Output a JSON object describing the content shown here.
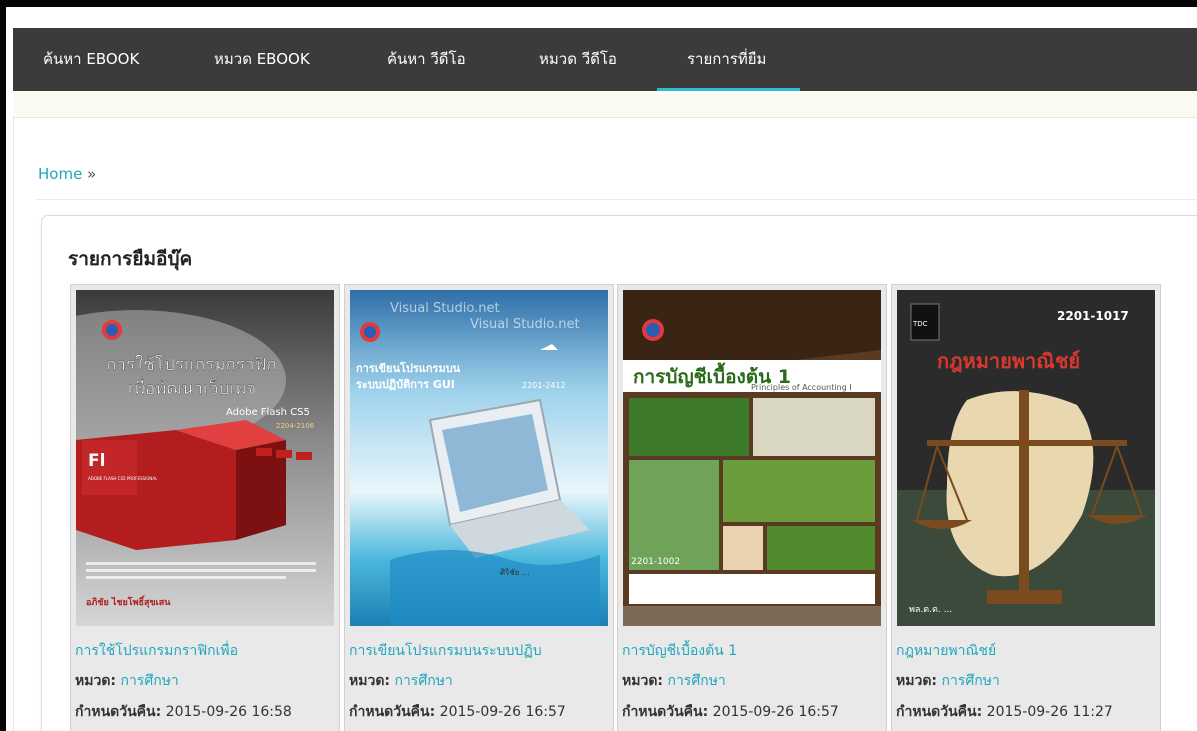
{
  "nav": {
    "items": [
      {
        "label": "ค้นหา EBOOK"
      },
      {
        "label": "หมวด EBOOK"
      },
      {
        "label": "ค้นหา วีดีโอ"
      },
      {
        "label": "หมวด วีดีโอ"
      },
      {
        "label": "รายการที่ยืม"
      }
    ],
    "active_index": 4
  },
  "breadcrumb": {
    "home": "Home",
    "separator": "»"
  },
  "section": {
    "title": "รายการยืมอีบุ๊ค"
  },
  "labels": {
    "category": "หมวด:",
    "due": "กำหนดวันคืน:"
  },
  "colors": {
    "accent": "#21a6bf",
    "nav_bg": "#3b3b3b",
    "active_underline": "#2dbcd3"
  },
  "books": [
    {
      "title": "การใช้โปรแกรมกราฟิกเพื่อ",
      "category": "การศึกษา",
      "due": "2015-09-26 16:58",
      "cover": {
        "title_line1": "การใช้โปรแกรมกราฟิก",
        "title_line2": "เพื่อพัฒนาเว็บเพจ",
        "subtitle": "Adobe Flash CS5",
        "code": "2204-2106",
        "logo_text": "Fl",
        "product_name": "ADOBE FLASH CS5 PROFESSIONAL",
        "author": "อภิชัย ไชยโพธิ์สุขเสน"
      }
    },
    {
      "title": "การเขียนโปรแกรมบนระบบปฏิบ",
      "category": "การศึกษา",
      "due": "2015-09-26 16:57",
      "cover": {
        "watermark": "Visual Studio.net",
        "title_line1": "การเขียนโปรแกรมบน",
        "title_line2": "ระบบปฏิบัติการ GUI",
        "code": "2201-2412"
      }
    },
    {
      "title": "การบัญชีเบื้องต้น 1",
      "category": "การศึกษา",
      "due": "2015-09-26 16:57",
      "cover": {
        "title": "การบัญชีเบื้องต้น 1",
        "subtitle": "Principles of Accounting I",
        "code": "2201-1002"
      }
    },
    {
      "title": "กฎหมายพาณิชย์",
      "category": "การศึกษา",
      "due": "2015-09-26 11:27",
      "cover": {
        "code": "2201-1017",
        "title": "กฎหมายพาณิชย์",
        "badge_letters": "TDC"
      }
    }
  ]
}
